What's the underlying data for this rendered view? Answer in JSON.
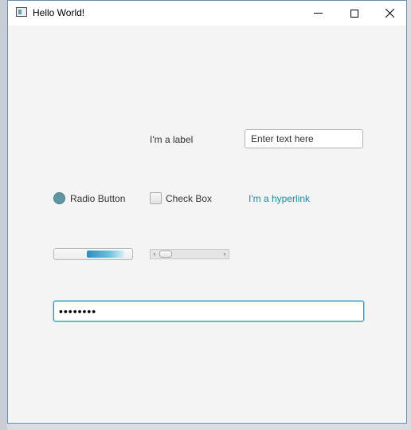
{
  "window": {
    "title": "Hello World!",
    "icon": "app-window-icon",
    "controls": {
      "minimize": "minimize-icon",
      "maximize": "maximize-icon",
      "close": "close-icon"
    }
  },
  "form": {
    "label_text": "I'm a label",
    "text_field": {
      "value": "",
      "placeholder": "Enter text here"
    },
    "radio_label": "Radio Button",
    "radio_checked": true,
    "checkbox_label": "Check Box",
    "checkbox_checked": false,
    "hyperlink_text": "I'm a hyperlink",
    "progress": {
      "value": 0.45,
      "indeterminate_segment_start": 0.42,
      "indeterminate_segment_end": 1.0
    },
    "scrollbar": {
      "position": 0.0
    },
    "password": {
      "value": "secret12",
      "masked_length": 8
    }
  },
  "colors": {
    "accent": "#1a8aa0",
    "focus_border": "#1f9bc8",
    "radio_fill": "#5e96a4",
    "window_bg": "#f4f4f4"
  }
}
